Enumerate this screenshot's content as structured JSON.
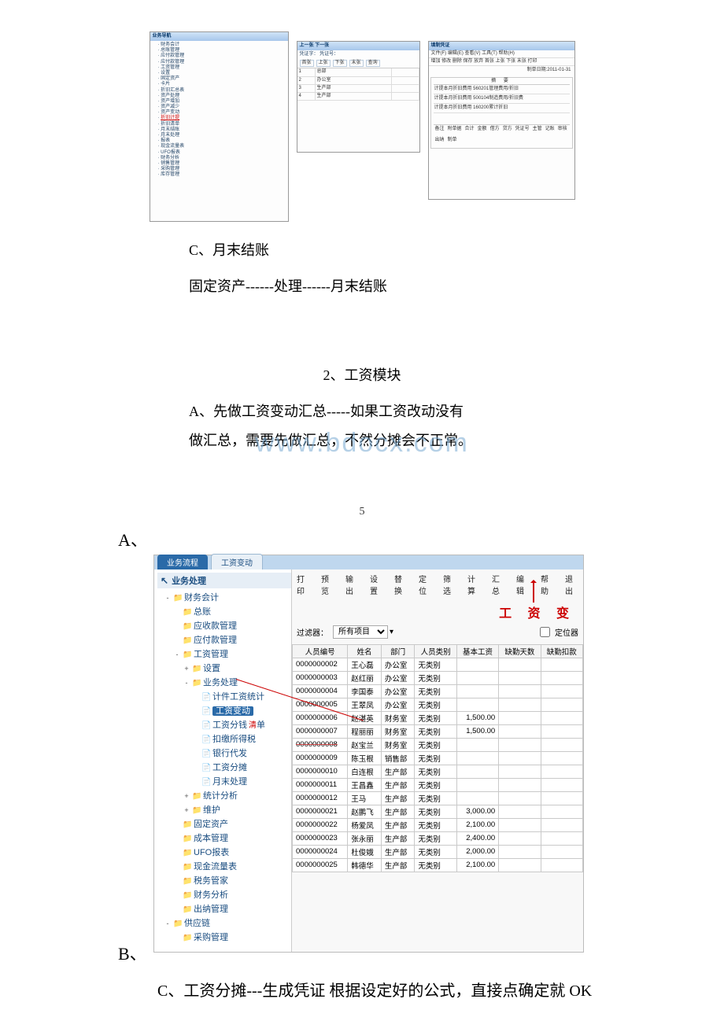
{
  "top": {
    "left_title": "业务导航",
    "left_tree": [
      "财务会计",
      "总账管理",
      "应付款管理",
      "应付款管理",
      "工资管理",
      "设置",
      "固定资产",
      "卡片",
      "折旧汇总表",
      "资产处理",
      "资产增加",
      "资产减少",
      "资产变动",
      "折旧计提",
      "折旧清单",
      "月末结账",
      "月末处理",
      "报表",
      "现金流量表",
      "UFO报表",
      "财务分析",
      "销售管理",
      "采购管理",
      "库存管理"
    ],
    "left_highlight": "折旧计提",
    "mid_header": "上一张    下一张",
    "mid_sub": "凭证字：   凭证号：",
    "mid_btns": [
      "首张",
      "上张",
      "下张",
      "末张",
      "查询"
    ],
    "mid_rows": [
      "总部",
      "办公室",
      "生产部",
      "生产部"
    ],
    "right_title": "填制凭证",
    "right_menu": "文件(F)  编辑(E)  查看(V)  工具(T)  帮助(H)",
    "right_tb": "增加  修改  删除  保存  放弃  首张  上张  下张  末张  打印",
    "right_date": "制单日期:2011-01-31",
    "right_head": "摘    要",
    "right_rows": [
      "计提本月折旧费用  560201管理费用/折旧",
      "计提本月折旧费用  500104制造费用/折旧费",
      "计提本月折旧费用  160200累计折旧"
    ],
    "right_foot_labels": [
      "备注",
      "附单据",
      "合计",
      "金额",
      "借方",
      "贷方",
      "凭证号",
      "主管",
      "记账",
      "审核",
      "出纳",
      "制单"
    ]
  },
  "text": {
    "c_line": "C、月末结账",
    "fa_line": "固定资产------处理------月末结账",
    "section2": "2、工资模块",
    "a_line": "A、先做工资变动汇总-----如果工资改动没有",
    "a_line2": "做汇总，需要先做汇总，不然分摊会不正常。",
    "watermark": "www.bdocx.com",
    "page_num": "5",
    "bullet_a": "A、",
    "bullet_b": "B、",
    "final": "C、工资分摊---生成凭证 根据设定好的公式，直接点确定就 OK"
  },
  "app": {
    "tabs": {
      "inactive": "业务流程",
      "active": "工资变动"
    },
    "sidebar_title": "业务处理",
    "tree": [
      {
        "fold": "-",
        "ico": "folder",
        "label": "财务会计"
      },
      {
        "fold": " ",
        "ico": "folder",
        "label": "总账",
        "indent": 1
      },
      {
        "fold": " ",
        "ico": "folder",
        "label": "应收款管理",
        "indent": 1
      },
      {
        "fold": " ",
        "ico": "folder",
        "label": "应付款管理",
        "indent": 1
      },
      {
        "fold": "-",
        "ico": "folder",
        "label": "工资管理",
        "indent": 1
      },
      {
        "fold": "+",
        "ico": "folder",
        "label": "设置",
        "indent": 2
      },
      {
        "fold": "-",
        "ico": "folder",
        "label": "业务处理",
        "indent": 2
      },
      {
        "fold": " ",
        "ico": "file",
        "label": "计件工资统计",
        "indent": 3
      },
      {
        "fold": " ",
        "ico": "file",
        "label": "工资变动",
        "indent": 3,
        "sel": true
      },
      {
        "fold": " ",
        "ico": "file",
        "label": "工资分钱清单",
        "indent": 3,
        "red": true
      },
      {
        "fold": " ",
        "ico": "file",
        "label": "扣缴所得税",
        "indent": 3
      },
      {
        "fold": " ",
        "ico": "file",
        "label": "银行代发",
        "indent": 3
      },
      {
        "fold": " ",
        "ico": "file",
        "label": "工资分摊",
        "indent": 3
      },
      {
        "fold": " ",
        "ico": "file",
        "label": "月末处理",
        "indent": 3
      },
      {
        "fold": "+",
        "ico": "folder",
        "label": "统计分析",
        "indent": 2
      },
      {
        "fold": "+",
        "ico": "folder",
        "label": "维护",
        "indent": 2
      },
      {
        "fold": " ",
        "ico": "folder",
        "label": "固定资产",
        "indent": 1
      },
      {
        "fold": " ",
        "ico": "folder",
        "label": "成本管理",
        "indent": 1
      },
      {
        "fold": " ",
        "ico": "folder",
        "label": "UFO报表",
        "indent": 1
      },
      {
        "fold": " ",
        "ico": "folder",
        "label": "现金流量表",
        "indent": 1
      },
      {
        "fold": " ",
        "ico": "folder",
        "label": "税务管家",
        "indent": 1
      },
      {
        "fold": " ",
        "ico": "folder",
        "label": "财务分析",
        "indent": 1
      },
      {
        "fold": " ",
        "ico": "folder",
        "label": "出纳管理",
        "indent": 1
      },
      {
        "fold": "-",
        "ico": "folder",
        "label": "供应链"
      },
      {
        "fold": " ",
        "ico": "folder",
        "label": "采购管理",
        "indent": 1
      }
    ],
    "toolbar": [
      "打印",
      "预览",
      "输出",
      "设置",
      "替换",
      "定位",
      "筛选",
      "计算",
      "汇总",
      "编辑",
      "帮助",
      "退出"
    ],
    "main_title": "工  资  变",
    "filter_label": "过滤器：",
    "filter_value": "所有项目",
    "locator_label": "定位器",
    "columns": [
      "人员编号",
      "姓名",
      "部门",
      "人员类别",
      "基本工资",
      "缺勤天数",
      "缺勤扣款"
    ],
    "rows": [
      {
        "id": "0000000002",
        "name": "王心磊",
        "dept": "办公室",
        "cat": "无类别",
        "base": ""
      },
      {
        "id": "0000000003",
        "name": "赵红丽",
        "dept": "办公室",
        "cat": "无类别",
        "base": ""
      },
      {
        "id": "0000000004",
        "name": "李国泰",
        "dept": "办公室",
        "cat": "无类别",
        "base": ""
      },
      {
        "id": "0000000005",
        "name": "王翠凤",
        "dept": "办公室",
        "cat": "无类别",
        "base": ""
      },
      {
        "id": "0000000006",
        "name": "赵湛英",
        "dept": "财务室",
        "cat": "无类别",
        "base": "1,500.00"
      },
      {
        "id": "0000000007",
        "name": "程丽丽",
        "dept": "财务室",
        "cat": "无类别",
        "base": "1,500.00"
      },
      {
        "id": "0000000008",
        "name": "赵宝兰",
        "dept": "财务室",
        "cat": "无类别",
        "base": "",
        "strike": true
      },
      {
        "id": "0000000009",
        "name": "陈玉根",
        "dept": "销售部",
        "cat": "无类别",
        "base": ""
      },
      {
        "id": "0000000010",
        "name": "白连根",
        "dept": "生产部",
        "cat": "无类别",
        "base": ""
      },
      {
        "id": "0000000011",
        "name": "王昌鑫",
        "dept": "生产部",
        "cat": "无类别",
        "base": ""
      },
      {
        "id": "0000000012",
        "name": "王马",
        "dept": "生产部",
        "cat": "无类别",
        "base": ""
      },
      {
        "id": "0000000021",
        "name": "赵鹏飞",
        "dept": "生产部",
        "cat": "无类别",
        "base": "3,000.00"
      },
      {
        "id": "0000000022",
        "name": "杨爱凤",
        "dept": "生产部",
        "cat": "无类别",
        "base": "2,100.00"
      },
      {
        "id": "0000000023",
        "name": "张永丽",
        "dept": "生产部",
        "cat": "无类别",
        "base": "2,400.00"
      },
      {
        "id": "0000000024",
        "name": "杜俊娥",
        "dept": "生产部",
        "cat": "无类别",
        "base": "2,000.00"
      },
      {
        "id": "0000000025",
        "name": "韩德华",
        "dept": "生产部",
        "cat": "无类别",
        "base": "2,100.00"
      }
    ]
  }
}
